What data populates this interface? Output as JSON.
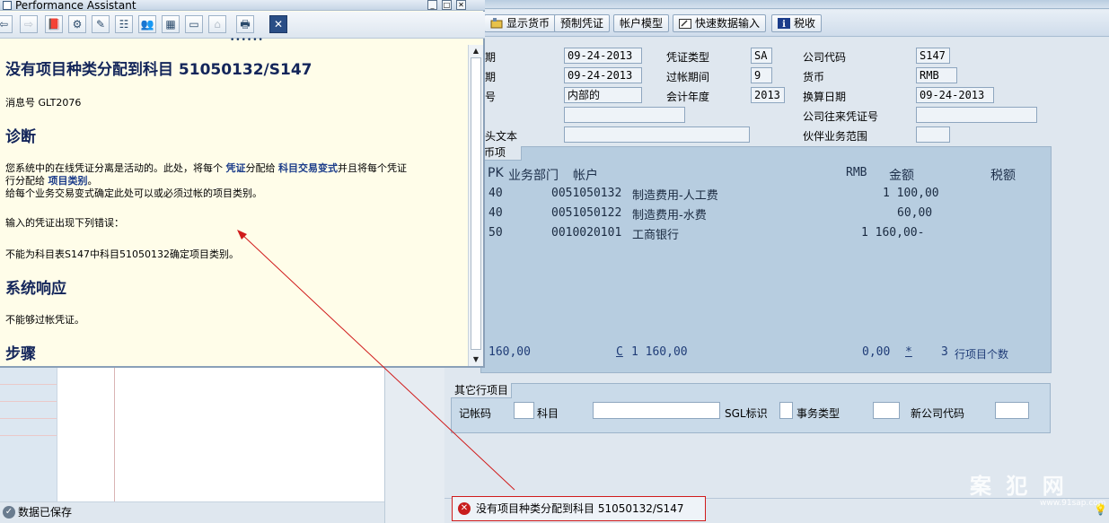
{
  "performance_assistant": {
    "window_title": "Performance Assistant",
    "heading": "没有项目种类分配到科目 51050132/S147",
    "message_number": "消息号 GLT2076",
    "diagnosis_heading": "诊断",
    "diagnosis_line1_a": "您系统中的在线凭证分离是活动的。此处，将每个",
    "diagnosis_line1_link1": "凭证",
    "diagnosis_line1_b": "分配给",
    "diagnosis_line1_link2": "科目交易变式",
    "diagnosis_line1_c": "并且将每个凭证",
    "diagnosis_line2_a": "行分配给",
    "diagnosis_line2_link": "项目类别",
    "diagnosis_line2_b": "。",
    "diagnosis_line3": "给每个业务交易变式确定此处可以或必须过帐的项目类别。",
    "error_intro": "输入的凭证出现下列错误：",
    "error_detail": "不能为科目表S147中科目51050132确定项目类别。",
    "system_response_heading": "系统响应",
    "system_response_text": "不能够过帐凭证。",
    "procedure_heading": "步骤"
  },
  "toolbar": {
    "show_currency": "显示货币",
    "preliminary_voucher": "预制凭证",
    "account_model": "帐户模型",
    "fast_entry": "快速数据输入",
    "tax": "税收"
  },
  "header_fields": {
    "row1_label_a": "期",
    "document_date": "09-24-2013",
    "doc_type_label": "凭证类型",
    "doc_type": "SA",
    "company_code_label": "公司代码",
    "company_code": "S147",
    "row2_label_a": "期",
    "posting_date": "09-24-2013",
    "period_label": "过帐期间",
    "period": "9",
    "currency_label": "货币",
    "currency": "RMB",
    "row3_label_a": "号",
    "reference": "内部的",
    "fiscal_year_label": "会计年度",
    "fiscal_year": "2013",
    "translation_date_label": "换算日期",
    "translation_date": "09-24-2013",
    "reference_field": "",
    "intercompany_label": "公司往来凭证号",
    "intercompany": "",
    "header_text_label": "头文本",
    "header_text": "",
    "partner_ba_label": "伙伴业务范围",
    "partner_ba": ""
  },
  "items": {
    "tab_label": "币项",
    "col_pk": "PK",
    "col_ba": "业务部门",
    "col_account": "帐户",
    "col_currency": "RMB",
    "col_amount": "金额",
    "col_tax": "税额",
    "rows": [
      {
        "pk": "40",
        "account": "0051050132",
        "name": "制造费用-人工费",
        "amount": "1 100,00"
      },
      {
        "pk": "40",
        "account": "0051050122",
        "name": "制造费用-水费",
        "amount": "60,00"
      },
      {
        "pk": "50",
        "account": "0010020101",
        "name": "工商银行",
        "amount": "1 160,00-"
      }
    ],
    "total_debit": "160,00",
    "total_credit_flag": "C",
    "total_credit": "1 160,00",
    "balance": "0,00",
    "balance_marker": "*",
    "line_count": "3",
    "line_count_label": "行项目个数"
  },
  "other_line": {
    "title": "其它行项目",
    "posting_key_label": "记帐码",
    "account_label": "科目",
    "sgl_label": "SGL标识",
    "trans_type_label": "事务类型",
    "new_company_label": "新公司代码"
  },
  "status": {
    "error_message": "没有项目种类分配到科目 51050132/S147",
    "left_message": "数据已保存"
  },
  "watermark": {
    "text": "案 犯 网",
    "url": "www.91sap.com"
  },
  "colors": {
    "error_red": "#d01b1b",
    "heading_blue": "#13255a",
    "link_blue": "#1b3c8a",
    "panel_yellow": "#fffde9"
  }
}
